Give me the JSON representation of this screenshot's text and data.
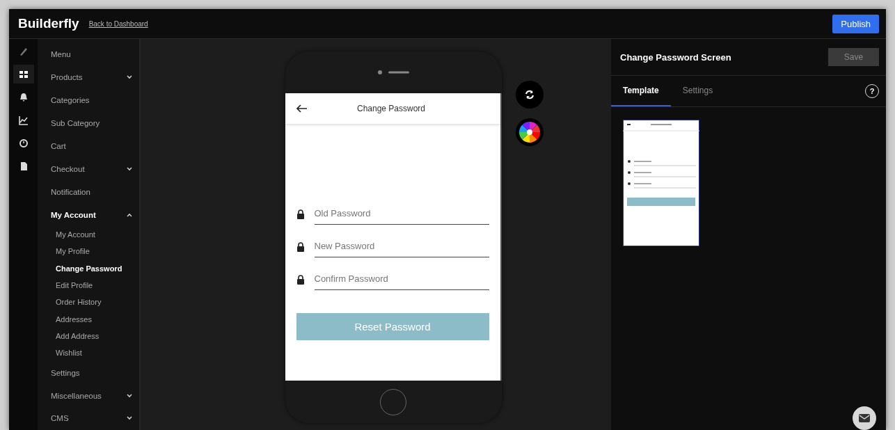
{
  "topbar": {
    "logo": "Builderfly",
    "back_link": "Back to Dashboard",
    "publish": "Publish"
  },
  "rail": [
    {
      "selected": false
    },
    {
      "selected": true
    },
    {
      "selected": false
    },
    {
      "selected": false
    },
    {
      "selected": false
    },
    {
      "selected": false
    }
  ],
  "nav": [
    {
      "label": "Menu",
      "selected": false
    },
    {
      "label": "Products",
      "selected": false,
      "expanded": false
    },
    {
      "label": "Categories",
      "selected": false
    },
    {
      "label": "Sub Category",
      "selected": false
    },
    {
      "label": "Cart",
      "selected": false
    },
    {
      "label": "Checkout",
      "selected": false,
      "expanded": false
    },
    {
      "label": "Notification",
      "selected": false
    },
    {
      "label": "My Account",
      "selected": true,
      "expanded": true,
      "children": [
        {
          "label": "My Account",
          "selected": false
        },
        {
          "label": "My Profile",
          "selected": false
        },
        {
          "label": "Change Password",
          "selected": true
        },
        {
          "label": "Edit Profile",
          "selected": false
        },
        {
          "label": "Order History",
          "selected": false
        },
        {
          "label": "Addresses",
          "selected": false
        },
        {
          "label": "Add Address",
          "selected": false
        },
        {
          "label": "Wishlist",
          "selected": false
        }
      ]
    },
    {
      "label": "Settings",
      "selected": false
    },
    {
      "label": "Miscellaneous",
      "selected": false,
      "expanded": false
    },
    {
      "label": "CMS",
      "selected": false,
      "expanded": false
    }
  ],
  "phone": {
    "title": "Change Password",
    "fields": [
      {
        "placeholder": "Old Password"
      },
      {
        "placeholder": "New Password"
      },
      {
        "placeholder": "Confirm Password"
      }
    ],
    "button": "Reset Password"
  },
  "panel": {
    "title": "Change Password Screen",
    "save": "Save",
    "tabs": [
      {
        "label": "Template",
        "selected": true
      },
      {
        "label": "Settings",
        "selected": false
      }
    ],
    "help": "?"
  }
}
